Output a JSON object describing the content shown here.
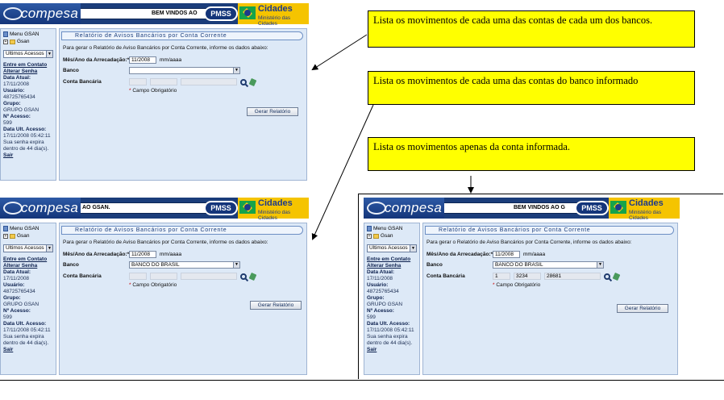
{
  "callouts": [
    "Lista os movimentos de cada uma das contas de cada um dos bancos.",
    "Lista os movimentos de cada uma das contas do banco informado",
    "Lista os movimentos apenas da conta informada."
  ],
  "screens": [
    {
      "brand": "compesa",
      "welcome": "BEM VINDOS AO",
      "pmss": "PMSS",
      "cidades_title": "Cidades",
      "cidades_sub": "Ministério das Cidades",
      "sidebar": {
        "menu": "Menu GSAN",
        "gsan": "Gsan",
        "acessos": "Ultimos Acessos",
        "contato": "Entre em Contato",
        "alterar": "Alterar Senha",
        "data_atual_label": "Data Atual:",
        "data_atual": "17/11/2008",
        "usuario_label": "Usuário:",
        "usuario": "48725765434",
        "grupo_label": "Grupo:",
        "grupo": "GRUPO GSAN",
        "acesso_label": "Nº Acesso:",
        "acesso": "599",
        "ult_label": "Data Ult. Acesso:",
        "ult": "17/11/2008 05:42:11",
        "expira": "Sua senha expira dentro de 44 dia(s).",
        "sair": "Sair"
      },
      "form": {
        "title": "Relatório de Avisos Bancários por Conta Corrente",
        "desc": "Para gerar o Relatório de Aviso Bancários por Conta Corrente, informe os dados abaixo:",
        "mes_label": "Mês/Ano da Arrecadação:*",
        "mes_value": "11/2008",
        "mes_hint": "mm/aaaa",
        "banco_label": "Banco",
        "banco_value": "",
        "conta_label": "Conta Bancária",
        "conta_vals": [
          "",
          "",
          ""
        ],
        "required": "Campo Obrigatório",
        "button": "Gerar Relatório"
      }
    },
    {
      "brand": "compesa",
      "welcome": "AO GSAN.",
      "pmss": "PMSS",
      "cidades_title": "Cidades",
      "cidades_sub": "Ministério das Cidades",
      "sidebar": {
        "menu": "Menu GSAN",
        "gsan": "Gsan",
        "acessos": "Ultimos Acessos",
        "contato": "Entre em Contato",
        "alterar": "Alterar Senha",
        "data_atual_label": "Data Atual:",
        "data_atual": "17/11/2008",
        "usuario_label": "Usuário:",
        "usuario": "48725765434",
        "grupo_label": "Grupo:",
        "grupo": "GRUPO GSAN",
        "acesso_label": "Nº Acesso:",
        "acesso": "599",
        "ult_label": "Data Ult. Acesso:",
        "ult": "17/11/2008 05:42:11",
        "expira": "Sua senha expira dentro de 44 dia(s).",
        "sair": "Sair"
      },
      "form": {
        "title": "Relatório de Avisos Bancários por Conta Corrente",
        "desc": "Para gerar o Relatório de Aviso Bancários por Conta Corrente, informe os dados abaixo:",
        "mes_label": "Mês/Ano da Arrecadação:*",
        "mes_value": "11/2008",
        "mes_hint": "mm/aaaa",
        "banco_label": "Banco",
        "banco_value": "BANCO DO BRASIL",
        "conta_label": "Conta Bancária",
        "conta_vals": [
          "",
          "",
          ""
        ],
        "required": "Campo Obrigatório",
        "button": "Gerar Relatório"
      }
    },
    {
      "brand": "compesa",
      "welcome": "BEM VINDOS AO G",
      "pmss": "PMSS",
      "cidades_title": "Cidades",
      "cidades_sub": "Ministério das Cidades",
      "sidebar": {
        "menu": "Menu GSAN",
        "gsan": "Gsan",
        "acessos": "Ultimos Acessos",
        "contato": "Entre em Contato",
        "alterar": "Alterar Senha",
        "data_atual_label": "Data Atual:",
        "data_atual": "17/11/2008",
        "usuario_label": "Usuário:",
        "usuario": "48725765434",
        "grupo_label": "Grupo:",
        "grupo": "GRUPO GSAN",
        "acesso_label": "Nº Acesso:",
        "acesso": "599",
        "ult_label": "Data Ult. Acesso:",
        "ult": "17/11/2008 05:42:11",
        "expira": "Sua senha expira dentro de 44 dia(s).",
        "sair": "Sair"
      },
      "form": {
        "title": "Relatório de Avisos Bancários por Conta Corrente",
        "desc": "Para gerar o Relatório de Aviso Bancários por Conta Corrente, informe os dados abaixo:",
        "mes_label": "Mês/Ano da Arrecadação:*",
        "mes_value": "11/2008",
        "mes_hint": "mm/aaaa",
        "banco_label": "Banco",
        "banco_value": "BANCO DO BRASIL",
        "conta_label": "Conta Bancária",
        "conta_vals": [
          "1",
          "3234",
          "28681"
        ],
        "required": "Campo Obrigatório",
        "button": "Gerar Relatório"
      }
    }
  ]
}
